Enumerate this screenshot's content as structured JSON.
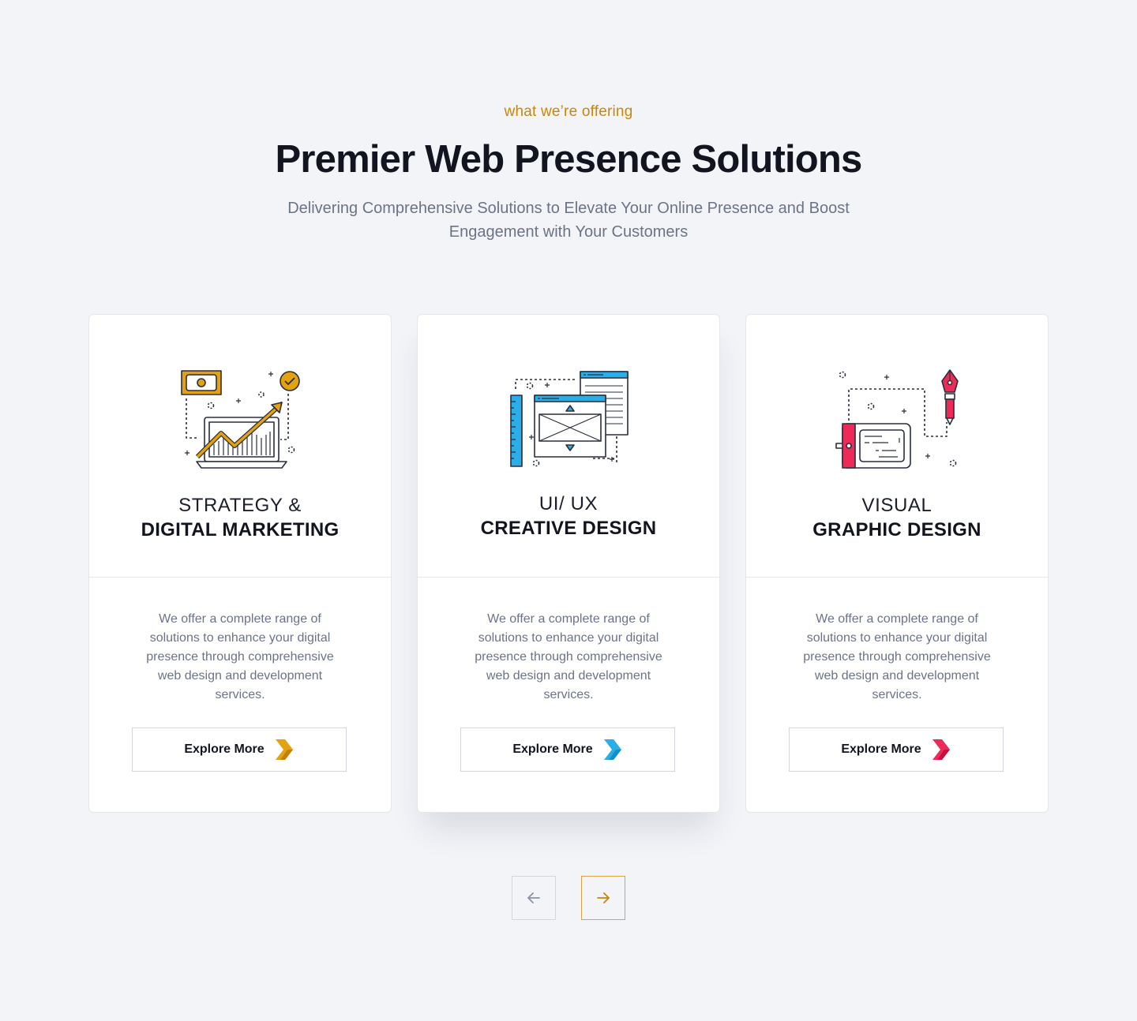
{
  "header": {
    "eyebrow": "what we’re offering",
    "title": "Premier Web Presence Solutions",
    "subtitle": "Delivering Comprehensive Solutions to Elevate Your Online Presence and Boost Engagement with Your Customers"
  },
  "cards": [
    {
      "icon": "growth-chart-laptop-icon",
      "heading_light": "STRATEGY &",
      "heading_bold": "DIGITAL MARKETING",
      "description": "We offer a complete range of solutions to enhance your digital presence through comprehensive web design and development services.",
      "button_label": "Explore More",
      "accent": "#e3a20f"
    },
    {
      "icon": "wireframe-windows-icon",
      "heading_light": "UI/ UX",
      "heading_bold": "CREATIVE DESIGN",
      "description": "We offer a complete range of solutions to enhance your digital presence through comprehensive web design and development services.",
      "button_label": "Explore More",
      "accent": "#2aaee8"
    },
    {
      "icon": "pen-tablet-icon",
      "heading_light": "VISUAL",
      "heading_bold": "GRAPHIC DESIGN",
      "description": "We offer a complete range of solutions to enhance your digital presence through comprehensive web design and development services.",
      "button_label": "Explore More",
      "accent": "#ee2a59"
    }
  ],
  "carousel": {
    "prev_icon": "arrow-left-icon",
    "next_icon": "arrow-right-icon",
    "active_color": "#d9a441"
  }
}
